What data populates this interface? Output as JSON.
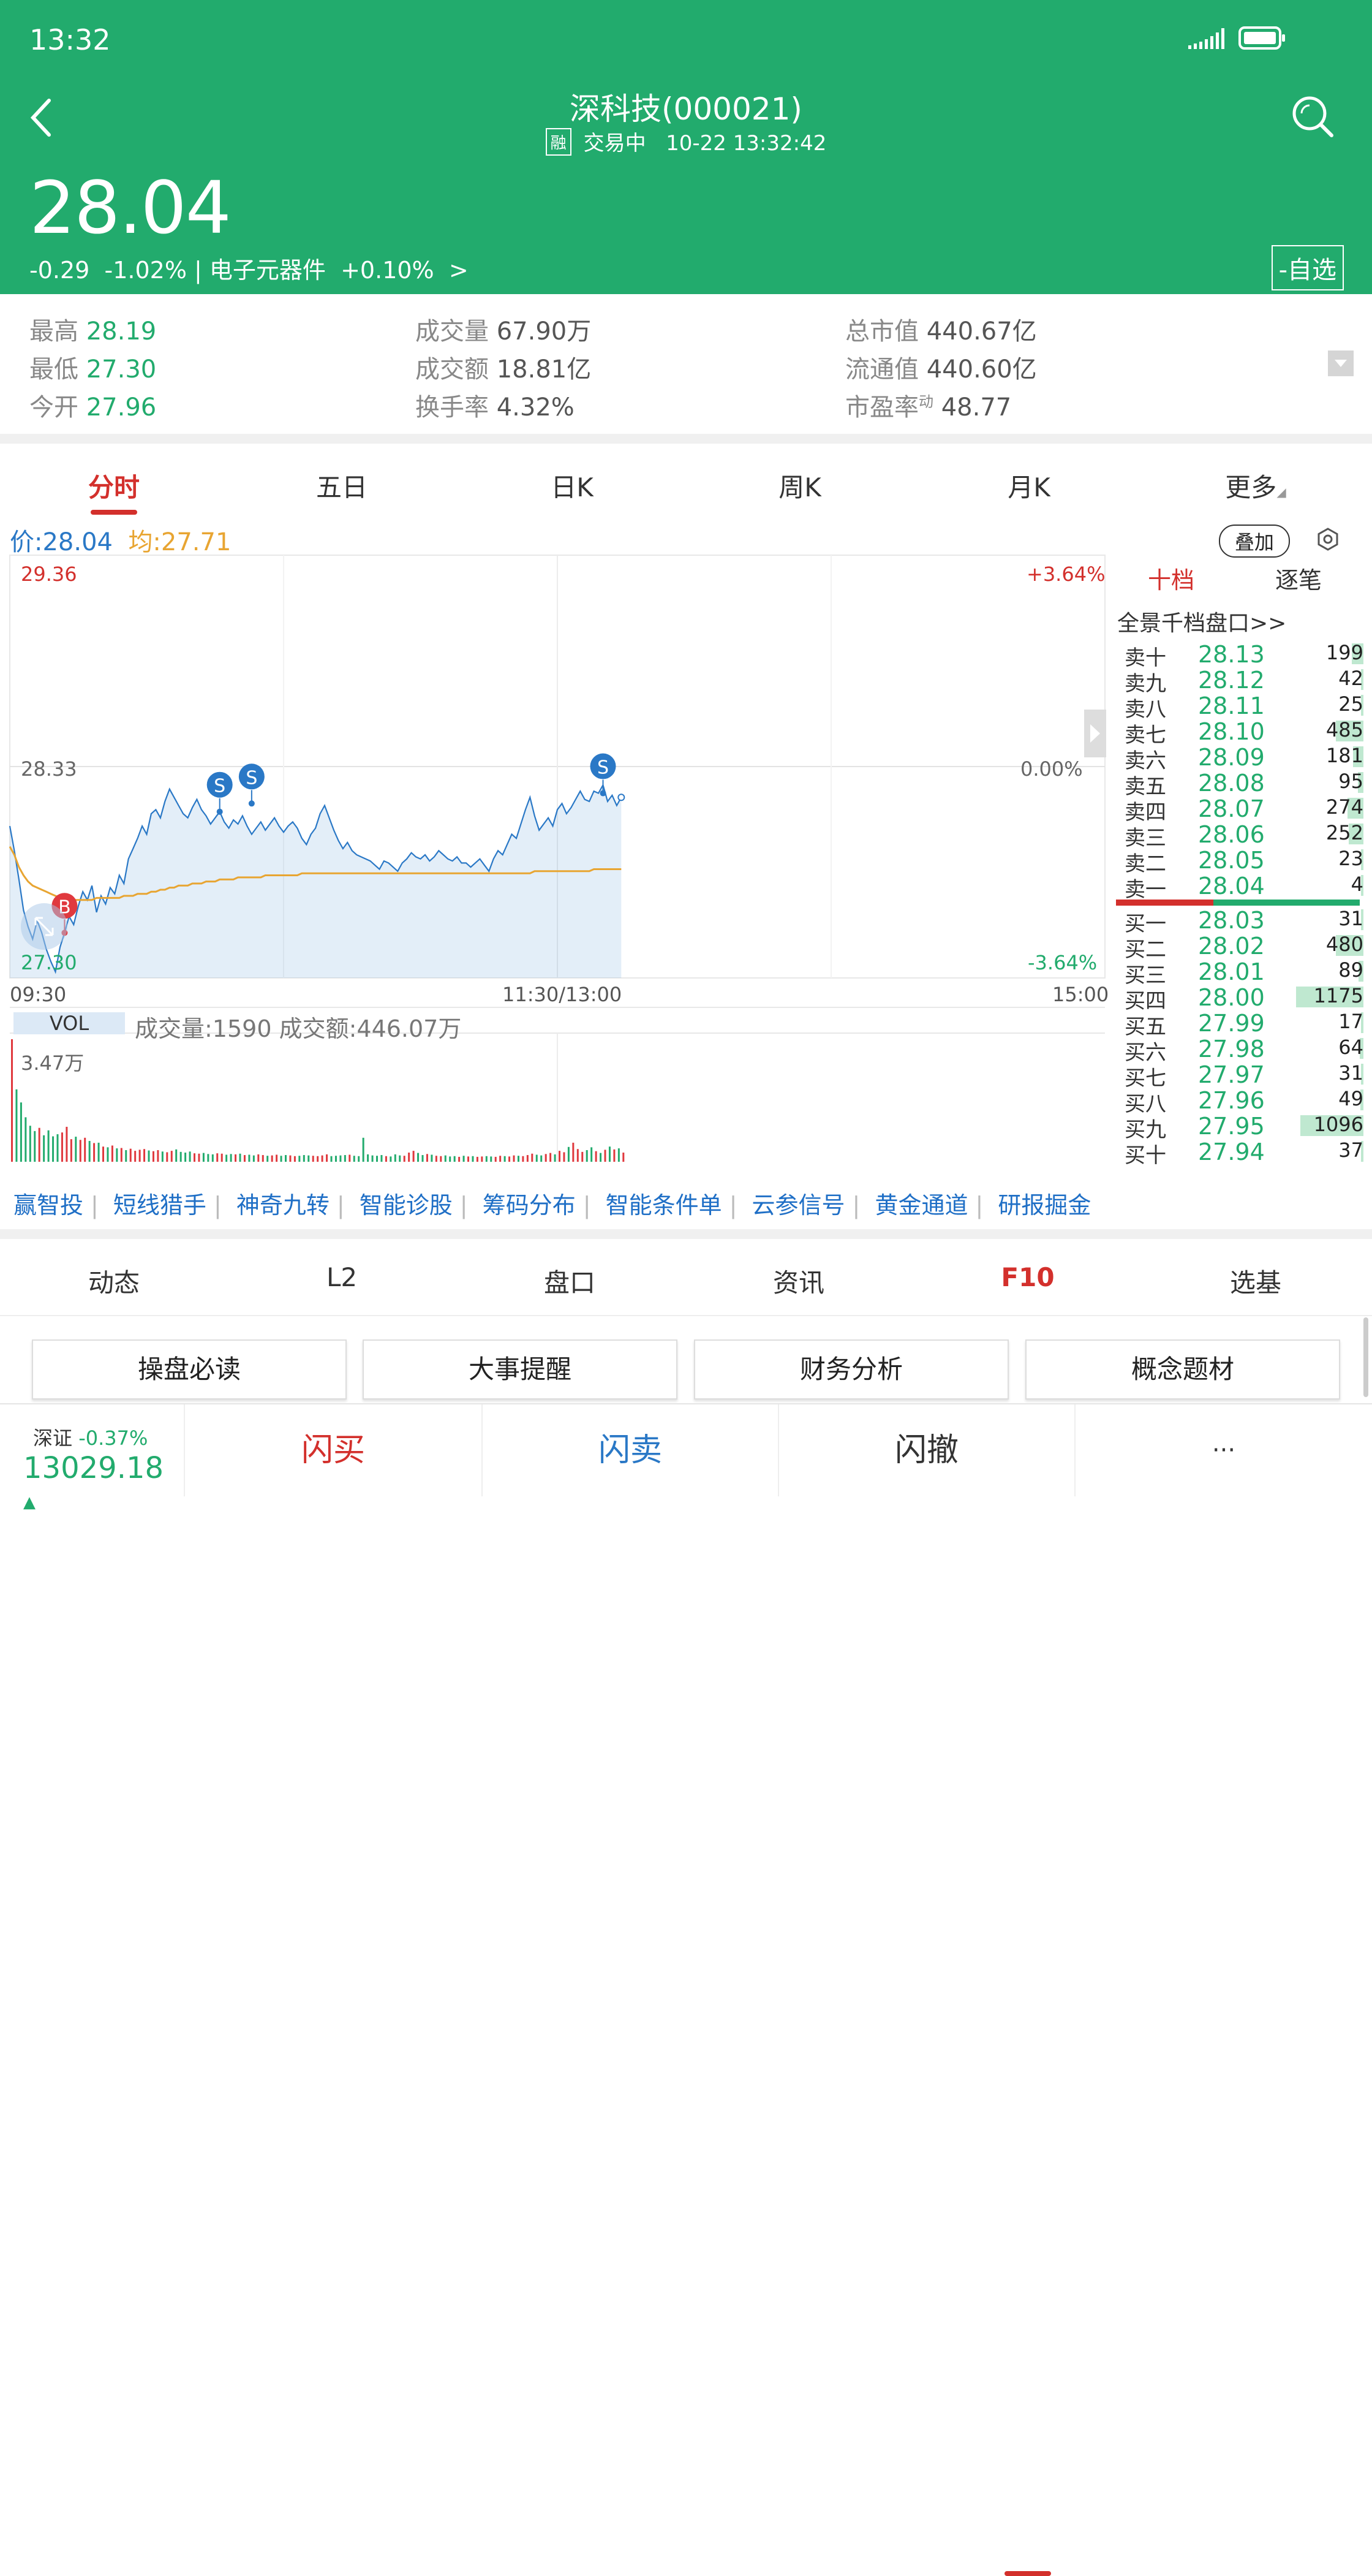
{
  "status": {
    "time": "13:32"
  },
  "header": {
    "title": "深科技(000021)",
    "badge": "融",
    "trading_status": "交易中",
    "datetime": "10-22 13:32:42",
    "price": "28.04",
    "change": "-0.29",
    "change_pct": "-1.02%",
    "sector": "电子元器件",
    "sector_pct": "+0.10%",
    "arrow": ">",
    "watch_button": "-自选"
  },
  "stats": {
    "high_label": "最高",
    "high": "28.19",
    "low_label": "最低",
    "low": "27.30",
    "open_label": "今开",
    "open": "27.96",
    "vol_label": "成交量",
    "vol": "67.90万",
    "amt_label": "成交额",
    "amt": "18.81亿",
    "turnover_label": "换手率",
    "turnover": "4.32%",
    "mcap_label": "总市值",
    "mcap": "440.67亿",
    "float_label": "流通值",
    "float": "440.60亿",
    "pe_label": "市盈率",
    "pe_sup": "动",
    "pe": "48.77"
  },
  "chart_tabs": [
    "分时",
    "五日",
    "日K",
    "周K",
    "月K",
    "更多"
  ],
  "chart_header": {
    "price_label": "价:28.04",
    "avg_label": "均:27.71",
    "overlay_button": "叠加"
  },
  "chart_data": {
    "type": "line",
    "title": "",
    "y_labels": {
      "top": "29.36",
      "mid": "28.33",
      "bottom": "27.30"
    },
    "pct_labels": {
      "top": "+3.64%",
      "mid": "0.00%",
      "bottom": "-3.64%"
    },
    "x_labels": [
      "09:30",
      "11:30/13:00",
      "15:00"
    ],
    "ylim": [
      27.3,
      29.36
    ],
    "prev_close": 28.33,
    "total_minutes": 240,
    "series": [
      {
        "name": "价",
        "color": "#2a78c6",
        "values": [
          28.04,
          27.92,
          27.78,
          27.63,
          27.55,
          27.49,
          27.58,
          27.52,
          27.44,
          27.38,
          27.33,
          27.45,
          27.52,
          27.6,
          27.56,
          27.65,
          27.72,
          27.68,
          27.75,
          27.62,
          27.7,
          27.66,
          27.74,
          27.71,
          27.8,
          27.76,
          27.88,
          27.93,
          27.98,
          28.04,
          28.0,
          28.1,
          28.12,
          28.08,
          28.16,
          28.22,
          28.18,
          28.14,
          28.1,
          28.08,
          28.13,
          28.17,
          28.12,
          28.09,
          28.05,
          28.08,
          28.11,
          28.06,
          28.03,
          28.07,
          28.05,
          28.09,
          28.04,
          28.0,
          28.03,
          28.06,
          28.02,
          28.05,
          28.08,
          28.04,
          28.01,
          28.04,
          28.06,
          28.03,
          27.98,
          27.95,
          28.0,
          28.03,
          28.1,
          28.14,
          28.08,
          28.02,
          27.97,
          27.93,
          27.96,
          27.92,
          27.9,
          27.89,
          27.88,
          27.87,
          27.85,
          27.83,
          27.87,
          27.86,
          27.84,
          27.82,
          27.86,
          27.88,
          27.91,
          27.89,
          27.88,
          27.9,
          27.87,
          27.89,
          27.92,
          27.9,
          27.88,
          27.87,
          27.89,
          27.86,
          27.86,
          27.84,
          27.86,
          27.88,
          27.85,
          27.82,
          27.88,
          27.92,
          27.9,
          27.95,
          28.0,
          27.98,
          28.05,
          28.12,
          28.18,
          28.09,
          28.02,
          28.05,
          28.08,
          28.04,
          28.12,
          28.15,
          28.1,
          28.13,
          28.17,
          28.21,
          28.17,
          28.16,
          28.21,
          28.2,
          28.24,
          28.16,
          28.19,
          28.14,
          28.18
        ]
      },
      {
        "name": "均",
        "color": "#e8a532",
        "values": [
          27.94,
          27.9,
          27.84,
          27.8,
          27.77,
          27.75,
          27.74,
          27.73,
          27.72,
          27.71,
          27.7,
          27.69,
          27.69,
          27.68,
          27.68,
          27.68,
          27.68,
          27.68,
          27.68,
          27.69,
          27.69,
          27.69,
          27.69,
          27.69,
          27.69,
          27.7,
          27.7,
          27.7,
          27.71,
          27.71,
          27.71,
          27.72,
          27.72,
          27.73,
          27.73,
          27.74,
          27.74,
          27.75,
          27.75,
          27.75,
          27.76,
          27.76,
          27.76,
          27.77,
          27.77,
          27.77,
          27.78,
          27.78,
          27.78,
          27.78,
          27.79,
          27.79,
          27.79,
          27.79,
          27.79,
          27.79,
          27.8,
          27.8,
          27.8,
          27.8,
          27.8,
          27.8,
          27.8,
          27.8,
          27.81,
          27.81,
          27.81,
          27.81,
          27.81,
          27.81,
          27.81,
          27.81,
          27.81,
          27.81,
          27.81,
          27.81,
          27.81,
          27.81,
          27.81,
          27.81,
          27.81,
          27.81,
          27.81,
          27.81,
          27.81,
          27.81,
          27.81,
          27.81,
          27.81,
          27.81,
          27.81,
          27.81,
          27.81,
          27.81,
          27.81,
          27.81,
          27.81,
          27.81,
          27.81,
          27.81,
          27.81,
          27.81,
          27.81,
          27.81,
          27.81,
          27.81,
          27.81,
          27.81,
          27.81,
          27.81,
          27.81,
          27.81,
          27.81,
          27.81,
          27.81,
          27.82,
          27.82,
          27.82,
          27.82,
          27.82,
          27.82,
          27.82,
          27.82,
          27.82,
          27.82,
          27.82,
          27.82,
          27.82,
          27.83,
          27.83,
          27.83,
          27.83,
          27.83,
          27.83,
          27.83
        ]
      }
    ],
    "markers": [
      {
        "label": "B",
        "index": 12,
        "value": 27.52,
        "color": "#e0393e"
      },
      {
        "label": "S",
        "index": 46,
        "value": 28.11,
        "color": "#2a78c6"
      },
      {
        "label": "S",
        "index": 53,
        "value": 28.15,
        "color": "#2a78c6"
      },
      {
        "label": "S",
        "index": 130,
        "value": 28.2,
        "color": "#2a78c6"
      }
    ],
    "volume": {
      "label": "VOL",
      "info": "成交量:1590 成交额:446.07万",
      "max_label": "3.47万",
      "max": 34700,
      "values": [
        34700,
        20500,
        16800,
        12600,
        10200,
        8700,
        9600,
        7500,
        8900,
        7200,
        7800,
        8300,
        9900,
        6400,
        7100,
        6200,
        6800,
        5900,
        5300,
        5400,
        4300,
        4100,
        4600,
        3800,
        3900,
        3300,
        3700,
        3100,
        3400,
        3600,
        3200,
        3000,
        3300,
        2900,
        2700,
        3100,
        3500,
        2800,
        2600,
        2900,
        2400,
        2300,
        2500,
        2200,
        2100,
        2400,
        2300,
        2000,
        2200,
        2100,
        2300,
        1900,
        2000,
        1800,
        2100,
        1900,
        1700,
        1800,
        2000,
        1700,
        1900,
        1800,
        1600,
        1700,
        1900,
        1800,
        1700,
        1600,
        1800,
        2100,
        1600,
        1700,
        1800,
        1900,
        2000,
        1700,
        1600,
        6800,
        2100,
        1800,
        1700,
        1900,
        1600,
        1500,
        2100,
        1800,
        1700,
        2600,
        3100,
        2500,
        1900,
        2200,
        2000,
        1700,
        1600,
        1800,
        1500,
        1600,
        1400,
        1700,
        1500,
        1600,
        1400,
        1500,
        1600,
        1500,
        1400,
        1700,
        1600,
        1500,
        1800,
        1700,
        1600,
        1900,
        2300,
        2000,
        1800,
        2200,
        2500,
        2100,
        3100,
        2700,
        4200,
        5400,
        3600,
        2800,
        3300,
        4100,
        3000,
        2500,
        3400,
        4300,
        3500,
        3800,
        2600
      ]
    }
  },
  "order_book": {
    "tabs": [
      "十档",
      "逐笔"
    ],
    "full_depth": "全景千档盘口>>",
    "asks": [
      {
        "level": "卖十",
        "price": "28.13",
        "vol": "199",
        "v": 199
      },
      {
        "level": "卖九",
        "price": "28.12",
        "vol": "42",
        "v": 42
      },
      {
        "level": "卖八",
        "price": "28.11",
        "vol": "25",
        "v": 25
      },
      {
        "level": "卖七",
        "price": "28.10",
        "vol": "485",
        "v": 485
      },
      {
        "level": "卖六",
        "price": "28.09",
        "vol": "181",
        "v": 181
      },
      {
        "level": "卖五",
        "price": "28.08",
        "vol": "95",
        "v": 95
      },
      {
        "level": "卖四",
        "price": "28.07",
        "vol": "274",
        "v": 274
      },
      {
        "level": "卖三",
        "price": "28.06",
        "vol": "252",
        "v": 252
      },
      {
        "level": "卖二",
        "price": "28.05",
        "vol": "23",
        "v": 23
      },
      {
        "level": "卖一",
        "price": "28.04",
        "vol": "4",
        "v": 4
      }
    ],
    "bids": [
      {
        "level": "买一",
        "price": "28.03",
        "vol": "31",
        "v": 31
      },
      {
        "level": "买二",
        "price": "28.02",
        "vol": "480",
        "v": 480
      },
      {
        "level": "买三",
        "price": "28.01",
        "vol": "89",
        "v": 89
      },
      {
        "level": "买四",
        "price": "28.00",
        "vol": "1175",
        "v": 1175
      },
      {
        "level": "买五",
        "price": "27.99",
        "vol": "17",
        "v": 17
      },
      {
        "level": "买六",
        "price": "27.98",
        "vol": "64",
        "v": 64
      },
      {
        "level": "买七",
        "price": "27.97",
        "vol": "31",
        "v": 31
      },
      {
        "level": "买八",
        "price": "27.96",
        "vol": "49",
        "v": 49
      },
      {
        "level": "买九",
        "price": "27.95",
        "vol": "1096",
        "v": 1096
      },
      {
        "level": "买十",
        "price": "27.94",
        "vol": "37",
        "v": 37
      }
    ],
    "max_vol": 1175,
    "buy_ratio": 0.4
  },
  "tools": [
    "赢智投",
    "短线猎手",
    "神奇九转",
    "智能诊股",
    "筹码分布",
    "智能条件单",
    "云参信号",
    "黄金通道",
    "研报掘金"
  ],
  "bottom_tabs": [
    "动态",
    "L2",
    "盘口",
    "资讯",
    "F10",
    "选基"
  ],
  "f10_buttons": [
    "操盘必读",
    "大事提醒",
    "财务分析",
    "概念题材"
  ],
  "footer": {
    "index_name": "深证",
    "index_change": "-0.37%",
    "index_value": "13029.18",
    "buy": "闪买",
    "sell": "闪卖",
    "cancel": "闪撤",
    "more": "···"
  }
}
